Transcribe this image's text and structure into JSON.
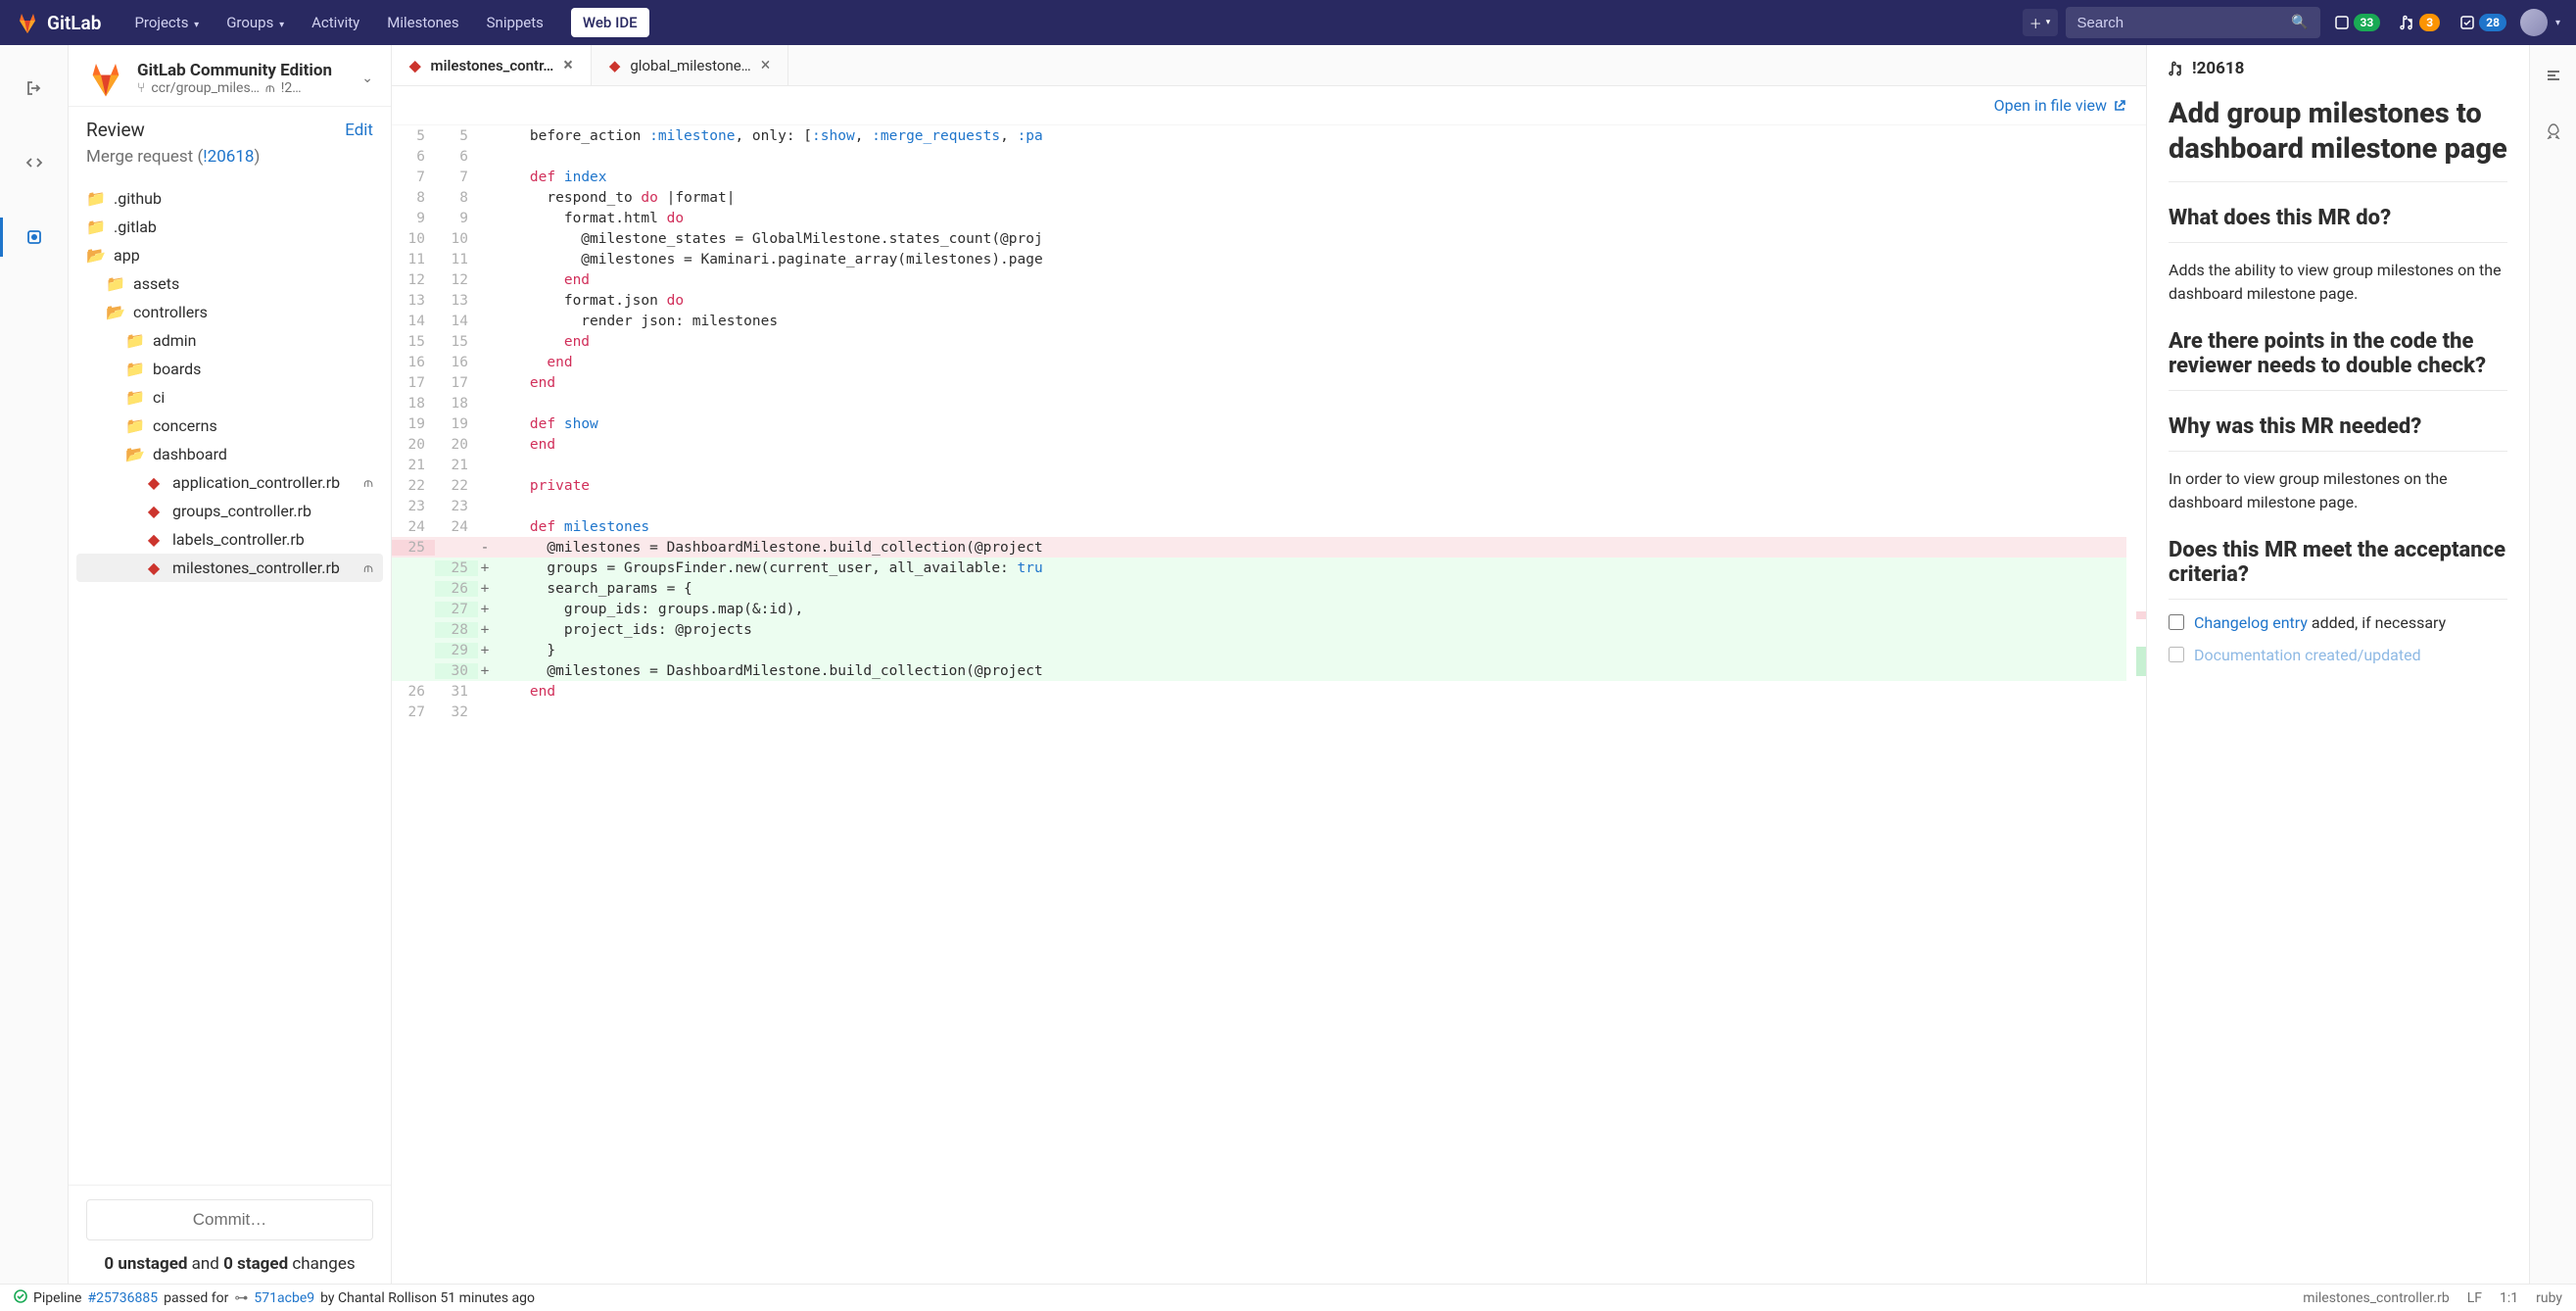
{
  "topnav": {
    "brand": "GitLab",
    "links": [
      "Projects",
      "Groups",
      "Activity",
      "Milestones",
      "Snippets"
    ],
    "webide": "Web IDE",
    "search_placeholder": "Search",
    "badges": {
      "issues": "33",
      "mrs": "3",
      "todos": "28"
    }
  },
  "project": {
    "name": "GitLab Community Edition",
    "branch": "ccr/group_miles…",
    "mr_short": "!2…"
  },
  "review": {
    "title": "Review",
    "edit": "Edit",
    "mr_prefix": "Merge request (",
    "mr_link": "!20618",
    "mr_suffix": ")"
  },
  "tree": [
    {
      "depth": 1,
      "icon": "folder",
      "label": ".github"
    },
    {
      "depth": 1,
      "icon": "folder",
      "label": ".gitlab"
    },
    {
      "depth": 1,
      "icon": "folder-open",
      "label": "app"
    },
    {
      "depth": 2,
      "icon": "folder",
      "label": "assets"
    },
    {
      "depth": 2,
      "icon": "folder-open",
      "label": "controllers"
    },
    {
      "depth": 3,
      "icon": "folder",
      "label": "admin"
    },
    {
      "depth": 3,
      "icon": "folder",
      "label": "boards"
    },
    {
      "depth": 3,
      "icon": "folder",
      "label": "ci"
    },
    {
      "depth": 3,
      "icon": "folder",
      "label": "concerns"
    },
    {
      "depth": 3,
      "icon": "folder-open",
      "label": "dashboard"
    },
    {
      "depth": 4,
      "icon": "ruby",
      "label": "application_controller.rb",
      "mr": true
    },
    {
      "depth": 4,
      "icon": "ruby",
      "label": "groups_controller.rb"
    },
    {
      "depth": 4,
      "icon": "ruby",
      "label": "labels_controller.rb"
    },
    {
      "depth": 4,
      "icon": "ruby",
      "label": "milestones_controller.rb",
      "mr": true,
      "selected": true
    }
  ],
  "commit": {
    "button": "Commit…",
    "unstaged": "0 unstaged",
    "and": "and",
    "staged": "0 staged",
    "changes": "changes"
  },
  "tabs": [
    {
      "file": "milestones_contr…",
      "active": true
    },
    {
      "file": "global_milestone…",
      "active": false
    }
  ],
  "open_in_file_view": "Open in file view",
  "code": [
    {
      "o": "5",
      "n": "5",
      "s": "",
      "t": "    before_action <span class='sym'>:milestone</span>, only: [<span class='sym'>:show</span>, <span class='sym'>:merge_requests</span>, <span class='sym'>:pa</span>"
    },
    {
      "o": "6",
      "n": "6",
      "s": "",
      "t": ""
    },
    {
      "o": "7",
      "n": "7",
      "s": "",
      "t": "    <span class='kw'>def</span> <span class='const'>index</span>"
    },
    {
      "o": "8",
      "n": "8",
      "s": "",
      "t": "      respond_to <span class='kw'>do</span> |format|"
    },
    {
      "o": "9",
      "n": "9",
      "s": "",
      "t": "        format.html <span class='kw'>do</span>"
    },
    {
      "o": "10",
      "n": "10",
      "s": "",
      "t": "          @milestone_states = GlobalMilestone.states_count(@proj"
    },
    {
      "o": "11",
      "n": "11",
      "s": "",
      "t": "          @milestones = Kaminari.paginate_array(milestones).page"
    },
    {
      "o": "12",
      "n": "12",
      "s": "",
      "t": "        <span class='kw'>end</span>"
    },
    {
      "o": "13",
      "n": "13",
      "s": "",
      "t": "        format.json <span class='kw'>do</span>"
    },
    {
      "o": "14",
      "n": "14",
      "s": "",
      "t": "          render json: milestones"
    },
    {
      "o": "15",
      "n": "15",
      "s": "",
      "t": "        <span class='kw'>end</span>"
    },
    {
      "o": "16",
      "n": "16",
      "s": "",
      "t": "      <span class='kw'>end</span>"
    },
    {
      "o": "17",
      "n": "17",
      "s": "",
      "t": "    <span class='kw'>end</span>"
    },
    {
      "o": "18",
      "n": "18",
      "s": "",
      "t": ""
    },
    {
      "o": "19",
      "n": "19",
      "s": "",
      "t": "    <span class='kw'>def</span> <span class='const'>show</span>"
    },
    {
      "o": "20",
      "n": "20",
      "s": "",
      "t": "    <span class='kw'>end</span>"
    },
    {
      "o": "21",
      "n": "21",
      "s": "",
      "t": ""
    },
    {
      "o": "22",
      "n": "22",
      "s": "",
      "t": "    <span class='kw'>private</span>"
    },
    {
      "o": "23",
      "n": "23",
      "s": "",
      "t": ""
    },
    {
      "o": "24",
      "n": "24",
      "s": "",
      "t": "    <span class='kw'>def</span> <span class='const'>milestones</span>"
    },
    {
      "o": "25",
      "n": "",
      "s": "-",
      "k": "del",
      "t": "      @milestones = DashboardMilestone.build_collection(@project"
    },
    {
      "o": "",
      "n": "25",
      "s": "+",
      "k": "add",
      "t": "      groups = GroupsFinder.new(current_user, all_available: <span class='const'>tru</span>"
    },
    {
      "o": "",
      "n": "26",
      "s": "+",
      "k": "add",
      "t": "      search_params = {"
    },
    {
      "o": "",
      "n": "27",
      "s": "+",
      "k": "add",
      "t": "        group_ids: groups.map(&amp;:id),"
    },
    {
      "o": "",
      "n": "28",
      "s": "+",
      "k": "add",
      "t": "        project_ids: @projects"
    },
    {
      "o": "",
      "n": "29",
      "s": "+",
      "k": "add",
      "t": "      }"
    },
    {
      "o": "",
      "n": "30",
      "s": "+",
      "k": "add",
      "t": "      @milestones = DashboardMilestone.build_collection(@project"
    },
    {
      "o": "26",
      "n": "31",
      "s": "",
      "t": "    <span class='kw'>end</span>"
    },
    {
      "o": "27",
      "n": "32",
      "s": "",
      "t": ""
    }
  ],
  "mr": {
    "id": "!20618",
    "title": "Add group milestones to dashboard milestone page",
    "h_what": "What does this MR do?",
    "p_what": "Adds the ability to view group milestones on the dashboard milestone page.",
    "h_check": "Are there points in the code the reviewer needs to double check?",
    "h_why": "Why was this MR needed?",
    "p_why": "In order to view group milestones on the dashboard milestone page.",
    "h_acc": "Does this MR meet the acceptance criteria?",
    "check1_link": "Changelog entry",
    "check1_rest": " added, if necessary",
    "check2_link": "Documentation created/updated"
  },
  "statusbar": {
    "pipeline_word": "Pipeline",
    "pipeline_id": "#25736885",
    "passed_for": "passed for",
    "commit": "571acbe9",
    "by": "by Chantal Rollison 51 minutes ago",
    "file": "milestones_controller.rb",
    "enc": "LF",
    "pos": "1:1",
    "lang": "ruby"
  }
}
